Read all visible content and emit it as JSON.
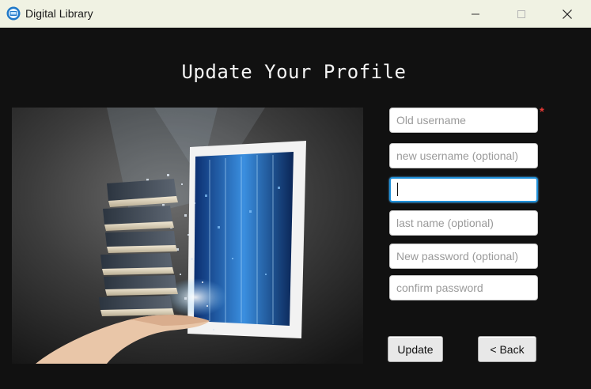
{
  "window": {
    "title": "Digital Library",
    "controls": [
      "minimize",
      "maximize",
      "close"
    ]
  },
  "page": {
    "title": "Update Your Profile"
  },
  "form": {
    "fields": [
      {
        "name": "old-username",
        "placeholder": "Old username",
        "value": "",
        "required": true
      },
      {
        "name": "new-username",
        "placeholder": "new username (optional)",
        "value": ""
      },
      {
        "name": "first-name",
        "placeholder": "",
        "value": "",
        "focused": true
      },
      {
        "name": "last-name",
        "placeholder": "last name (optional)",
        "value": ""
      },
      {
        "name": "new-password",
        "placeholder": "New password (optional)",
        "value": ""
      },
      {
        "name": "confirm-password",
        "placeholder": "confirm password",
        "value": ""
      }
    ],
    "required_marker": "*",
    "buttons": {
      "update": "Update",
      "back": "< Back"
    }
  },
  "colors": {
    "background": "#111111",
    "titlebar": "#f0f2e3",
    "focus_border": "#1e8fd8",
    "required": "#e53935"
  }
}
